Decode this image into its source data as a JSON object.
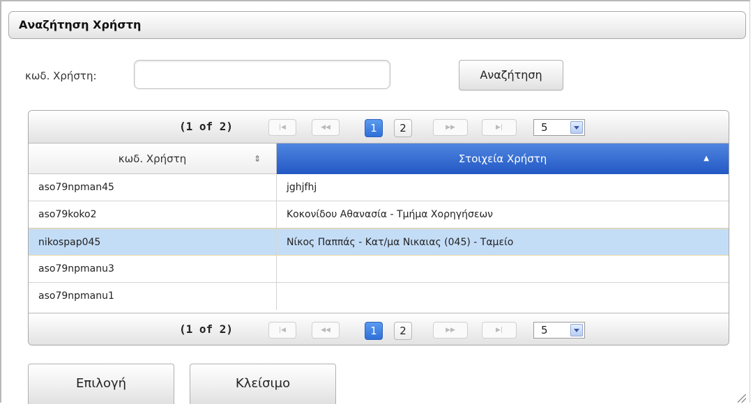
{
  "dialog": {
    "title": "Αναζήτηση Χρήστη"
  },
  "search": {
    "label": "κωδ. Χρήστη:",
    "value": "",
    "placeholder": "",
    "button_label": "Αναζήτηση"
  },
  "paginator": {
    "report": "(1 of 2)",
    "first_icon": "first-page-icon",
    "prev_icon": "previous-page-icon",
    "next_icon": "next-page-icon",
    "last_icon": "last-page-icon",
    "pages": [
      "1",
      "2"
    ],
    "current_page": "1",
    "rows_per_page": "5"
  },
  "table": {
    "columns": [
      {
        "label": "κωδ. Χρήστη",
        "sort_icon": "sort-updown-icon"
      },
      {
        "label": "Στοιχεία Χρήστη",
        "sort_icon": "sort-ascending-icon"
      }
    ],
    "rows": [
      {
        "id": "aso79npman45",
        "info": "jghjfhj"
      },
      {
        "id": "aso79koko2",
        "info": "Κοκονίδου Αθανασία - Τμήμα Χορηγήσεων"
      },
      {
        "id": "nikospap045",
        "info": "Νίκος Παππάς - Κατ/μα Νικαιας (045) - Ταμείο"
      },
      {
        "id": "aso79npmanu3",
        "info": ""
      },
      {
        "id": "aso79npmanu1",
        "info": ""
      }
    ],
    "selected_row_index": 2
  },
  "actions": {
    "select_label": "Επιλογή",
    "close_label": "Κλείσιμο"
  },
  "colors": {
    "accent_header": "#2f64cc",
    "selected_row": "#c4ddf7",
    "active_page": "#3a7be0"
  }
}
